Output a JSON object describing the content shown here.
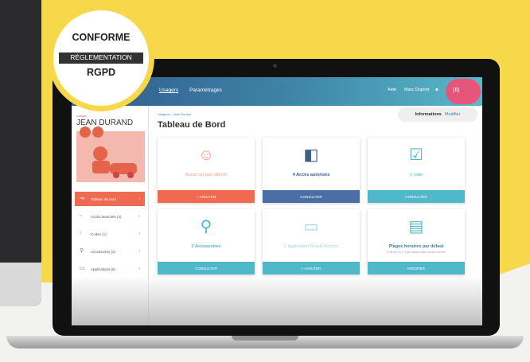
{
  "badge": {
    "line1": "CONFORME",
    "line2": "RÉGLEMENTATION",
    "line3": "RGPD"
  },
  "topbar": {
    "tab_users": "Usagers",
    "tab_settings": "Paramétrages",
    "help": "Aide",
    "user": "Marc Dupont",
    "notif": "(6)"
  },
  "profile": {
    "label": "Usager",
    "name": "JEAN DURAND"
  },
  "sidebar": {
    "items": [
      {
        "label": "Tableau de bord",
        "icon": "chart-icon"
      },
      {
        "label": "Accès autorisés (4)",
        "icon": "door-icon"
      },
      {
        "label": "Codes (1)",
        "icon": "code-icon"
      },
      {
        "label": "Accessoires (2)",
        "icon": "key-icon"
      },
      {
        "label": "Applications (6)",
        "icon": "app-icon"
      }
    ]
  },
  "main": {
    "breadcrumb": "Usagers > Jean Durand",
    "title": "Tableau de Bord",
    "info_button": "Informations",
    "info_link": "Modifier",
    "cards": [
      {
        "label": "Aucun groupe affecté",
        "button": "+ AJOUTER",
        "color": "#f06a52"
      },
      {
        "label": "4 Accès autorisés",
        "button": "CONSULTER",
        "color": "#4a6fa5"
      },
      {
        "label": "1 code",
        "button": "CONSULTER",
        "color": "#4fb8c9"
      },
      {
        "label": "2 Accessoires",
        "button": "CONSULTER",
        "color": "#4fb8c9"
      },
      {
        "label": "0 Application Roauh Access",
        "button": "+ AJOUTER",
        "color": "#4fb8c9"
      },
      {
        "label": "Plages horaires par défaut",
        "sub": "LUN SA TU IT jours fériés inclus, toutes l'année",
        "button": "MODIFIER",
        "color": "#4fb8c9"
      }
    ]
  }
}
